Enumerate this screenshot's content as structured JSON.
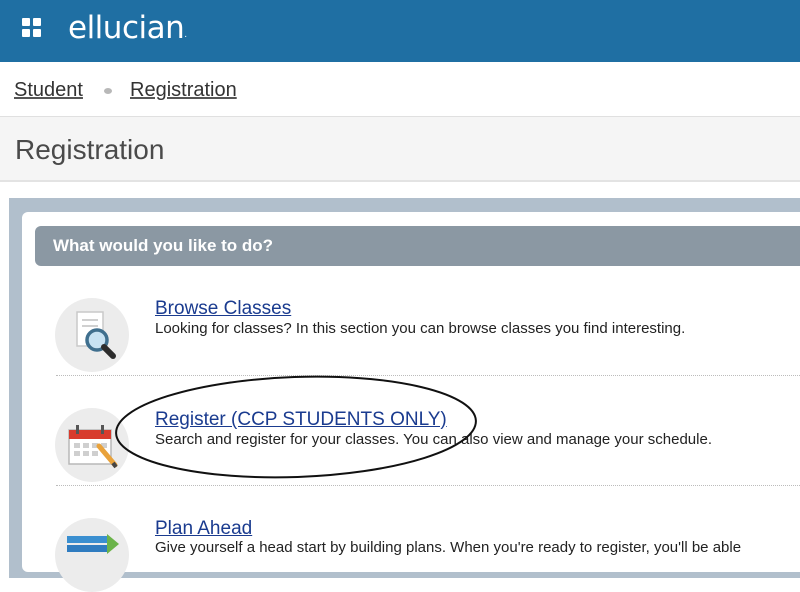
{
  "topbar": {
    "brand": "ellucian",
    "brand_mark": "."
  },
  "breadcrumb": {
    "items": [
      "Student",
      "Registration"
    ]
  },
  "page": {
    "title": "Registration"
  },
  "panel": {
    "heading": "What would you like to do?"
  },
  "options": [
    {
      "label": "Browse Classes",
      "description": "Looking for classes? In this section you can browse classes you find interesting.",
      "icon": "magnifier-document-icon"
    },
    {
      "label": "Register (CCP STUDENTS ONLY)",
      "description": "Search and register for your classes. You can also view and manage your schedule.",
      "icon": "calendar-pencil-icon"
    },
    {
      "label": "Plan Ahead",
      "description": "Give yourself a head start by building plans. When you're ready to register, you'll be able",
      "icon": "plan-stack-icon"
    }
  ],
  "colors": {
    "topbar": "#1f6fa3",
    "panel_header": "#8b98a3",
    "panel_border": "#b1bfcc",
    "link": "#1a3b8f"
  }
}
